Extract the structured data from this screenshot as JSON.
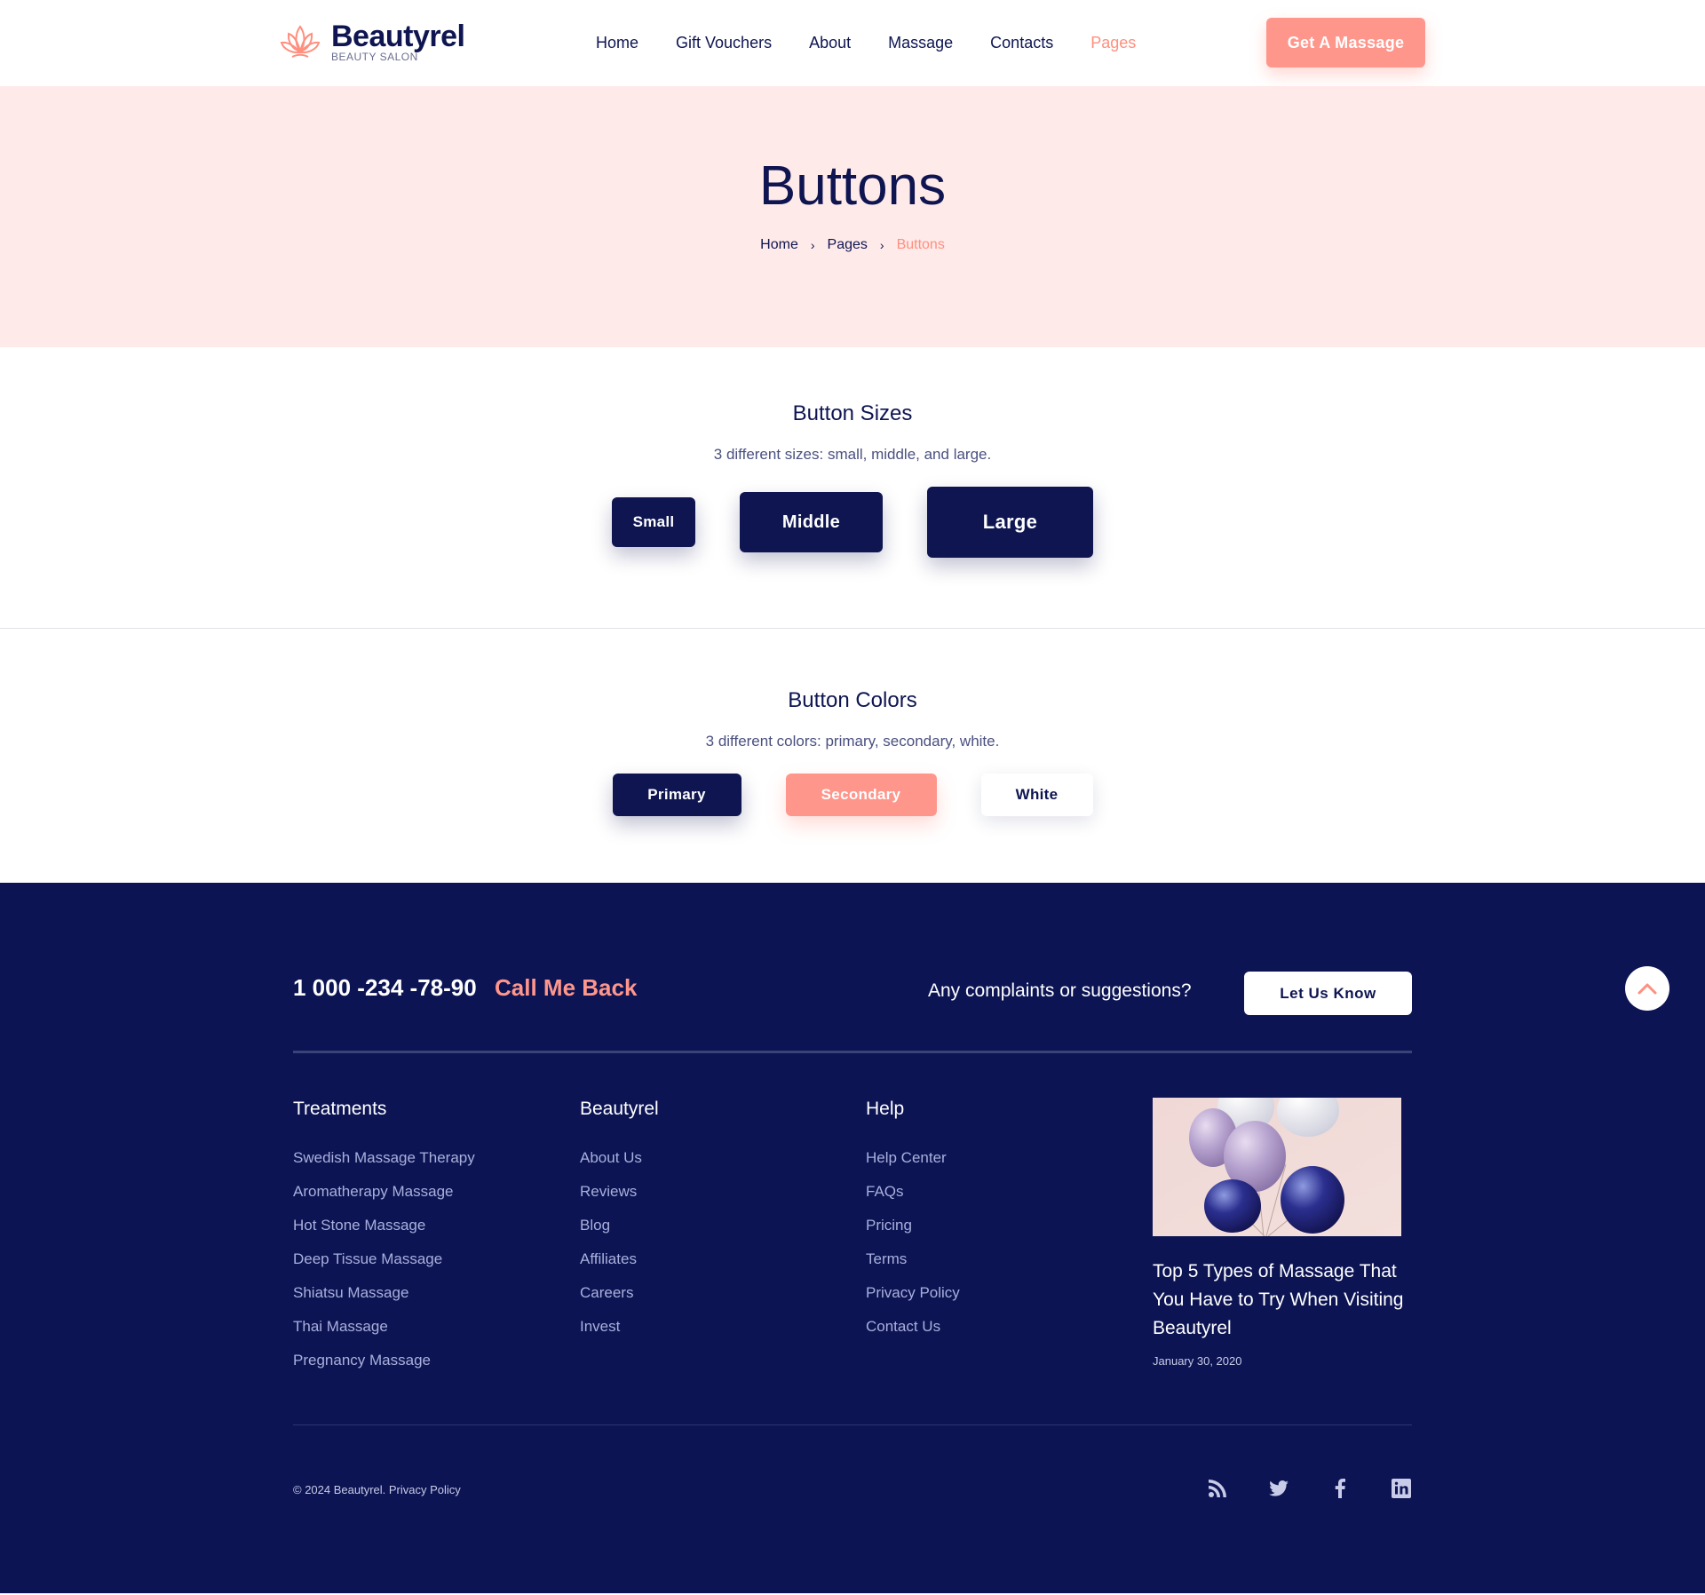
{
  "header": {
    "logo_name": "Beautyrel",
    "logo_sub": "BEAUTY SALON",
    "nav": [
      "Home",
      "Gift Vouchers",
      "About",
      "Massage",
      "Contacts",
      "Pages"
    ],
    "active_nav": "Pages",
    "cta_label": "Get A Massage"
  },
  "hero": {
    "title": "Buttons",
    "breadcrumb": [
      "Home",
      "Pages",
      "Buttons"
    ]
  },
  "sizes": {
    "title": "Button Sizes",
    "description": "3 different sizes: small, middle, and large.",
    "buttons": [
      "Small",
      "Middle",
      "Large"
    ]
  },
  "colors_section": {
    "title": "Button Colors",
    "description": "3 different colors: primary, secondary, white.",
    "buttons": [
      "Primary",
      "Secondary",
      "White"
    ]
  },
  "footer": {
    "phone": "1 000 -234 -78-90",
    "callback": "Call Me Back",
    "complaints": "Any complaints or suggestions?",
    "let_us_know": "Let Us Know",
    "columns": [
      {
        "title": "Treatments",
        "items": [
          "Swedish Massage Therapy",
          "Aromatherapy Massage",
          "Hot Stone Massage",
          "Deep Tissue Massage",
          "Shiatsu Massage",
          "Thai Massage",
          "Pregnancy Massage"
        ]
      },
      {
        "title": "Beautyrel",
        "items": [
          "About Us",
          "Reviews",
          "Blog",
          "Affiliates",
          "Careers",
          "Invest"
        ]
      },
      {
        "title": "Help",
        "items": [
          "Help Center",
          "FAQs",
          "Pricing",
          "Terms",
          "Privacy Policy",
          "Contact Us"
        ]
      }
    ],
    "post": {
      "title": "Top 5 Types of Massage That You Have to Try When Visiting Beautyrel",
      "date": "January 30, 2020"
    },
    "copyright": "©  2024 Beautyrel.",
    "privacy": "Privacy Policy",
    "socials": [
      "rss-icon",
      "twitter-icon",
      "facebook-icon",
      "linkedin-icon"
    ]
  },
  "colors": {
    "navy": "#0e1551",
    "footer_bg": "#0c1453",
    "accent": "#ff968b",
    "hero_bg": "#ffeaea"
  }
}
